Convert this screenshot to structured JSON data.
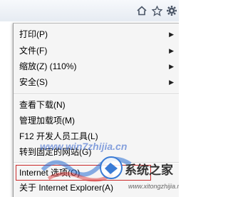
{
  "toolbar": {
    "icons": [
      "home-icon",
      "star-icon",
      "gear-icon"
    ]
  },
  "menu": {
    "items": [
      {
        "label": "打印(P)",
        "has_submenu": true
      },
      {
        "label": "文件(F)",
        "has_submenu": true
      },
      {
        "label": "缩放(Z) (110%)",
        "has_submenu": true
      },
      {
        "label": "安全(S)",
        "has_submenu": true
      },
      {
        "label": "查看下载(N)",
        "has_submenu": false
      },
      {
        "label": "管理加载项(M)",
        "has_submenu": false
      },
      {
        "label": "F12 开发人员工具(L)",
        "has_submenu": false
      },
      {
        "label": "转到固定的网站(G)",
        "has_submenu": false
      },
      {
        "label": "Internet 选项(O)",
        "has_submenu": false
      },
      {
        "label": "关于 Internet Explorer(A)",
        "has_submenu": false
      }
    ]
  },
  "watermark": {
    "text": "www.win7zhijia.cn",
    "logo_text": "系统之家",
    "site": "www.xitongzhijia.net"
  }
}
